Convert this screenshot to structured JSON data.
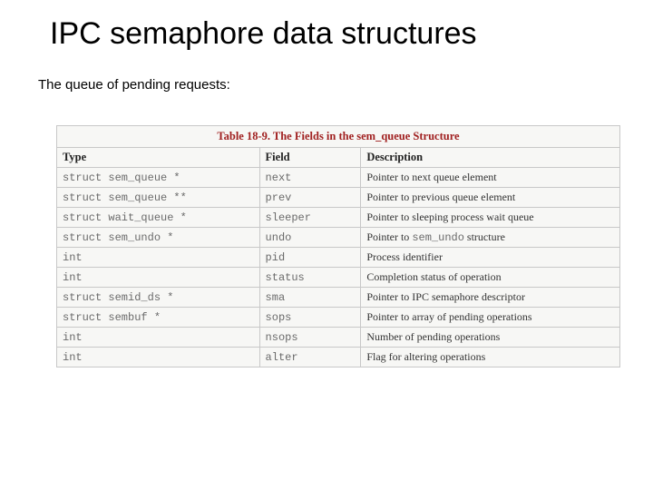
{
  "title": "IPC semaphore data structures",
  "subtitle": "The queue of pending requests:",
  "table": {
    "caption": "Table 18-9. The Fields in the sem_queue Structure",
    "headers": {
      "type": "Type",
      "field": "Field",
      "desc": "Description"
    },
    "rows": [
      {
        "type": "struct sem_queue *",
        "field": "next",
        "desc_pre": "Pointer to next queue element",
        "code": "",
        "desc_post": ""
      },
      {
        "type": "struct sem_queue **",
        "field": "prev",
        "desc_pre": "Pointer to previous queue element",
        "code": "",
        "desc_post": ""
      },
      {
        "type": "struct wait_queue *",
        "field": "sleeper",
        "desc_pre": "Pointer to sleeping process wait queue",
        "code": "",
        "desc_post": ""
      },
      {
        "type": "struct sem_undo *",
        "field": "undo",
        "desc_pre": "Pointer to ",
        "code": "sem_undo",
        "desc_post": " structure"
      },
      {
        "type": "int",
        "field": "pid",
        "desc_pre": "Process identifier",
        "code": "",
        "desc_post": ""
      },
      {
        "type": "int",
        "field": "status",
        "desc_pre": "Completion status of operation",
        "code": "",
        "desc_post": ""
      },
      {
        "type": "struct semid_ds *",
        "field": "sma",
        "desc_pre": "Pointer to IPC semaphore descriptor",
        "code": "",
        "desc_post": ""
      },
      {
        "type": "struct sembuf *",
        "field": "sops",
        "desc_pre": "Pointer to array of pending operations",
        "code": "",
        "desc_post": ""
      },
      {
        "type": "int",
        "field": "nsops",
        "desc_pre": "Number of pending operations",
        "code": "",
        "desc_post": ""
      },
      {
        "type": "int",
        "field": "alter",
        "desc_pre": "Flag for altering operations",
        "code": "",
        "desc_post": ""
      }
    ]
  }
}
